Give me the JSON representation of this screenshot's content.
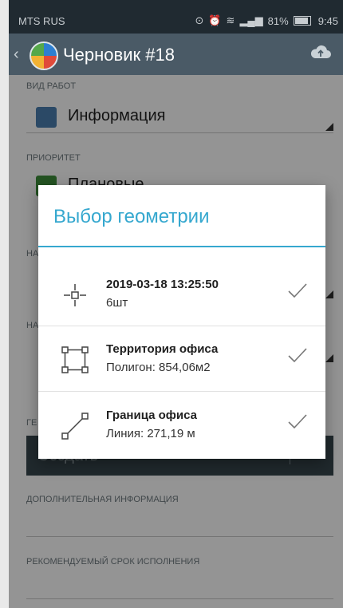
{
  "status_bar": {
    "carrier": "MTS RUS",
    "battery": "81%",
    "time": "9:45"
  },
  "app_bar": {
    "title": "Черновик #18"
  },
  "form": {
    "work_type": {
      "label": "ВИД РАБОТ",
      "value": "Информация"
    },
    "priority": {
      "label": "ПРИОРИТЕТ",
      "value": "Плановые"
    },
    "field3_label": "НА",
    "field4_label": "НА",
    "geometry_label": "ГЕ",
    "create_button": "Создать",
    "extra_info_label": "ДОПОЛНИТЕЛЬНАЯ ИНФОРМАЦИЯ",
    "deadline_label": "РЕКОМЕНДУЕМЫЙ СРОК ИСПОЛНЕНИЯ"
  },
  "dialog": {
    "title": "Выбор геометрии",
    "items": [
      {
        "name": "2019-03-18 13:25:50",
        "detail": "6шт",
        "icon": "point-icon"
      },
      {
        "name": "Территория офиса",
        "detail": "Полигон: 854,06м2",
        "icon": "polygon-icon"
      },
      {
        "name": "Граница офиса",
        "detail": "Линия: 271,19 м",
        "icon": "line-icon"
      }
    ]
  },
  "colors": {
    "accent": "#36a8cf",
    "app_bar": "#4a5a66",
    "status_bar": "#202a31"
  }
}
